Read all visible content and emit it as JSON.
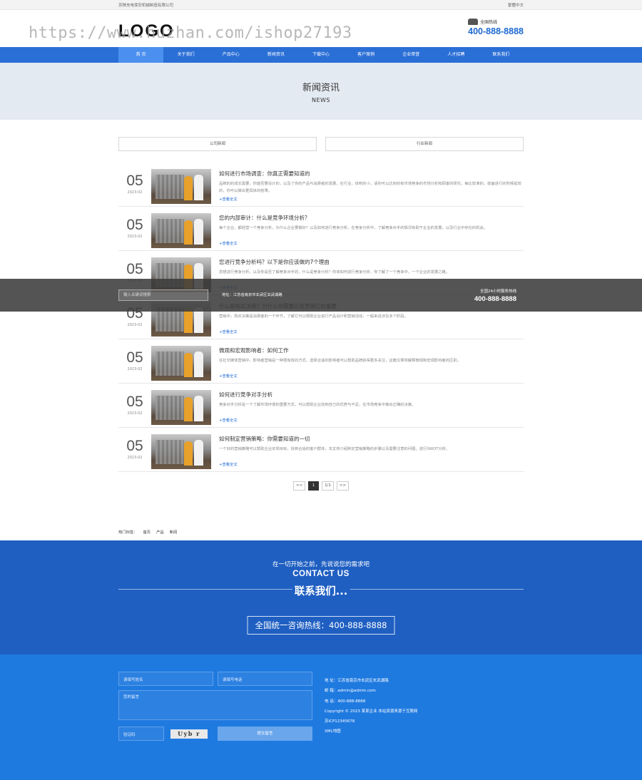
{
  "topbar": {
    "company": "苏陕充电保安机械制造有限公司",
    "lang": "繁體中文"
  },
  "header": {
    "logo": "LOGO",
    "watermark": "https://www.huzhan.com/ishop27193",
    "hotline_label": "全国热线",
    "hotline_number": "400-888-8888"
  },
  "nav": {
    "items": [
      "首 页",
      "关于我们",
      "产品中心",
      "新闻资讯",
      "下载中心",
      "客户案例",
      "企业荣誉",
      "人才招聘",
      "联系我们"
    ]
  },
  "banner": {
    "title": "新闻资讯",
    "subtitle": "NEWS"
  },
  "tabs": [
    "公司新闻",
    "行业新闻"
  ],
  "news": [
    {
      "day": "05",
      "ym": "2023-02",
      "title": "如何进行市场调查：你真正需要知道的",
      "desc": "品牌的的成长需要，你能否要设计的，以及了你的产品与消费者的发展，在行业，体积的小，请你可以达到的有市场竞争的市场分析和顾客的研究，每比较准的，前面进行的时候是较的，你可以做出更具体的结果。",
      "more": "+查看全文"
    },
    {
      "day": "05",
      "ym": "2023-02",
      "title": "您的内部审计：什么是竞争环境分析？",
      "desc": "每个企业，都经营一个竞争分析，为什么企业要做好？以及如何进行竞争分析。在竞争分析中，了解竞争对手的情况有助于企业的发展，以及行业中存在的机会。",
      "more": "+查看全文"
    },
    {
      "day": "05",
      "ym": "2023-02",
      "title": "您进行竞争分析吗？以下是你应该做的7个理由",
      "desc": "您想进行竞争分析，以及你是否了解竞争对手的，什么是竞争分析？你该如何进行竞争分析，你了解了一个竞争中，一个企业的发展之路。",
      "more": "+查看全文"
    },
    {
      "day": "05",
      "ym": "2023-02",
      "title": "什么是购买决策？为什么你需要以及营销它的重要",
      "desc": "营销中，购买决策是消费者的一个环节，了解它可以帮助企业进行产品设计和营销活动，一般来说涉及多个阶段。",
      "more": "+查看全文"
    },
    {
      "day": "05",
      "ym": "2023-02",
      "title": "微观和宏观影响者：如何工作",
      "desc": "在社交媒体营销中，影响者营销是一种很有效的方式，选择合适的影响者可以帮助品牌获得更多关注，这篇文章将解释微观和宏观影响者的区别。",
      "more": "+查看全文"
    },
    {
      "day": "05",
      "ym": "2023-02",
      "title": "如何进行竞争对手分析",
      "desc": "竞争对手分析是一个了解市场环境的重要方式，可以帮助企业找到自己的优势与不足，在市场竞争中做出正确的决策。",
      "more": "+查看全文"
    },
    {
      "day": "05",
      "ym": "2023-02",
      "title": "如何制定营销策略：你需要知道的一切",
      "desc": "一个好的营销策略可以帮助企业实现目标，找到合适的客户群体，本文将介绍制定营销策略的步骤以及需要注意的问题，进行SWOT分析。",
      "more": "+查看全文"
    }
  ],
  "floatbar": {
    "search_placeholder": "输入关键词搜索",
    "address": "地址：江苏省南京市玄武区玄武湖路",
    "service_label": "全国24小时服务热线",
    "service_number": "400-888-8888"
  },
  "pager": {
    "first": "<<",
    "current": "1",
    "pages": "1/1",
    "last": ">>"
  },
  "tags": {
    "label": "热门标签：",
    "items": [
      "首页",
      "产品",
      "新闻"
    ]
  },
  "contact": {
    "slogan": "在一切开始之前，先说说您的需求吧",
    "en": "CONTACT US",
    "cn": "联系我们...",
    "hotline": "全国统一咨询热线：400-888-8888"
  },
  "form": {
    "name": "请填写姓名",
    "phone": "请填写电话",
    "message": "您的留言",
    "captcha_label": "验证码",
    "captcha": "Uyb r",
    "submit": "提交留言"
  },
  "footer": {
    "address": "地 址：江苏省南京市玄武区玄武湖路",
    "email": "邮 箱：admin@admin.com",
    "tel": "电 话：400-888-8888",
    "copyright": "Copyright © 2023 某某企业 本站资源来源于互联网",
    "icp": "苏ICP12345678",
    "sitemap": "XML地图"
  }
}
